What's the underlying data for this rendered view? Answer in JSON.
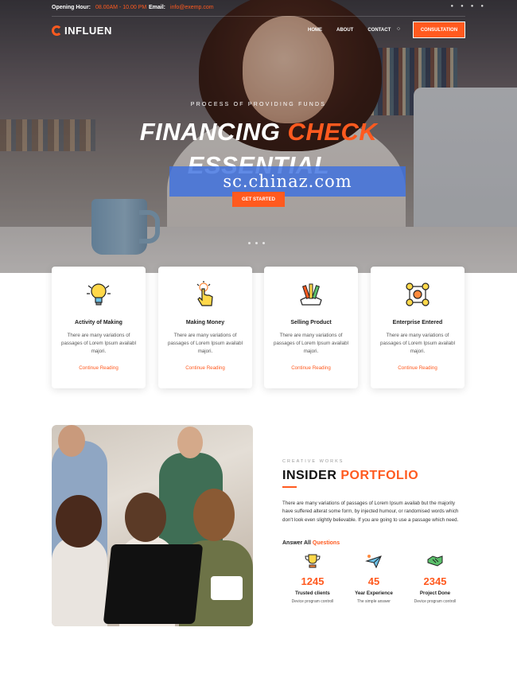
{
  "topbar": {
    "opening_label": "Opening Hour:",
    "opening_value": "08.00AM - 10.00 PM",
    "email_label": "Email:",
    "email_value": "info@exemp.com",
    "social_icons": [
      "facebook-icon",
      "twitter-icon",
      "dribbble-icon",
      "instagram-icon"
    ]
  },
  "header": {
    "logo_text": "INFLUEN",
    "nav": [
      "HOME",
      "ABOUT",
      "CONTACT"
    ],
    "cta": "CONSULTATION"
  },
  "hero": {
    "kicker": "PROCESS OF PROVIDING FUNDS",
    "title_line1_a": "FINANCING",
    "title_line1_b": "CHECK",
    "title_line2": "ESSENTIAL",
    "button": "GET STARTED",
    "watermark": "sc.chinaz.com"
  },
  "services": [
    {
      "icon": "lightbulb-icon",
      "title": "Activity of Making",
      "desc": "There are many variations of passages of Lorem Ipsum availabl majori.",
      "link": "Continue Reading"
    },
    {
      "icon": "touch-hand-icon",
      "title": "Making Money",
      "desc": "There are many variations of passages of Lorem Ipsum availabl majori.",
      "link": "Continue Reading"
    },
    {
      "icon": "pencils-icon",
      "title": "Selling Product",
      "desc": "There are many variations of passages of Lorem Ipsum availabl majori.",
      "link": "Continue Reading"
    },
    {
      "icon": "network-icon",
      "title": "Enterprise Entered",
      "desc": "There are many variations of passages of Lorem Ipsum availabl majori.",
      "link": "Continue Reading"
    }
  ],
  "portfolio": {
    "kicker": "CREATIVE WORKS",
    "title_a": "INSIDER",
    "title_b": "PORTFOLIO",
    "desc": "There are many variations of passages of Lorem Ipsum availab but the majority have suffered alterat some form, by injected humour, or randomised words which don't look even slightly believable. If you are going to use a passage which need.",
    "answer_a": "Answer All",
    "answer_b": "Questions",
    "stats": [
      {
        "icon": "trophy-icon",
        "value": "1245",
        "label": "Trusted clients",
        "sub": "Device program controll"
      },
      {
        "icon": "plane-icon",
        "value": "45",
        "label": "Year Experience",
        "sub": "The simple answer"
      },
      {
        "icon": "handshake-icon",
        "value": "2345",
        "label": "Project Done",
        "sub": "Device program controll"
      }
    ]
  },
  "colors": {
    "accent": "#ff5a1f",
    "watermark_box": "#3d70df"
  }
}
